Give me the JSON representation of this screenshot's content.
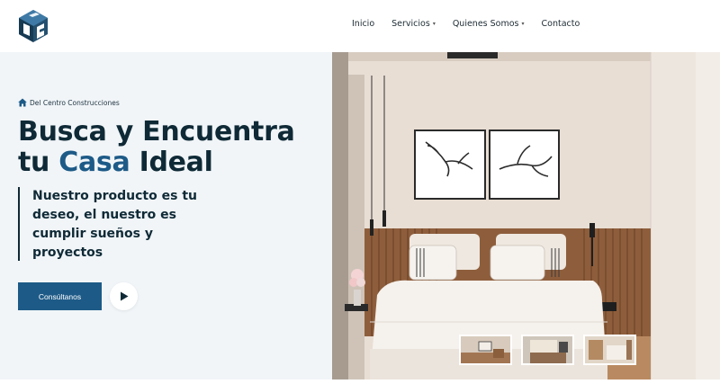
{
  "nav": {
    "items": [
      {
        "label": "Inicio",
        "has_caret": false
      },
      {
        "label": "Servicios",
        "has_caret": true
      },
      {
        "label": "Quienes Somos",
        "has_caret": true
      },
      {
        "label": "Contacto",
        "has_caret": false
      }
    ]
  },
  "hero": {
    "breadcrumb": "Del Centro Construcciones",
    "title_line1": "Busca y Encuentra",
    "title_line2_prefix": "tu",
    "title_line2_accent": "Casa",
    "title_line2_suffix": "Ideal",
    "subtitle": "Nuestro producto es tu deseo, el nuestro es cumplir sueños y proyectos",
    "cta_label": "Consúltanos"
  },
  "colors": {
    "brand_blue": "#1d5a87",
    "dark_navy": "#0f2a36",
    "panel_bg": "#f1f5f8"
  },
  "icons": {
    "logo": "company-logo",
    "home": "home-icon",
    "play": "play-icon",
    "caret": "caret-down-icon"
  }
}
